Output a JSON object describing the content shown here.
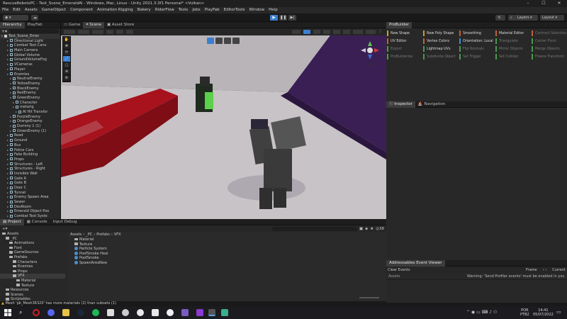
{
  "window": {
    "title": "RescueRobotsPC - Test_Scene_EmeraldAI - Windows, Mac, Linux - Unity 2021.3.3f1 Personal* <Vulkan>"
  },
  "menu": [
    "File",
    "Edit",
    "Assets",
    "GameObject",
    "Component",
    "Animation Rigging",
    "Bakery",
    "RiderFlow",
    "Tools",
    "Jobs",
    "PlayFab",
    "EditorTools",
    "Window",
    "Help"
  ],
  "toolbar": {
    "layers": "Layers",
    "layout": "Layout"
  },
  "hierarchy": {
    "tabs": [
      "Hierarchy",
      "PlayFab"
    ],
    "root": "Test_Scene_Emer",
    "items": [
      {
        "label": "Directional Light",
        "indent": 2
      },
      {
        "label": "Combat Text Canv",
        "indent": 2
      },
      {
        "label": "Main Camera",
        "indent": 2
      },
      {
        "label": "Global Volume",
        "indent": 2
      },
      {
        "label": "GroundVolumeFog",
        "indent": 2
      },
      {
        "label": "VCameras",
        "indent": 2
      },
      {
        "label": "Player",
        "indent": 2
      },
      {
        "label": "Enemies",
        "indent": 2
      },
      {
        "label": "NeutralEnemy",
        "indent": 3
      },
      {
        "label": "YellowEnemy",
        "indent": 3
      },
      {
        "label": "BlackEnemy",
        "indent": 3
      },
      {
        "label": "RedEnemy",
        "indent": 3
      },
      {
        "label": "GreenEnemy",
        "indent": 3
      },
      {
        "label": "Character",
        "indent": 4
      },
      {
        "label": "metarig",
        "indent": 4
      },
      {
        "label": "AI Hit Transfor",
        "indent": 5
      },
      {
        "label": "PurpleEnemy",
        "indent": 3
      },
      {
        "label": "OrangeEnemy",
        "indent": 3
      },
      {
        "label": "Dummy 1 (1)",
        "indent": 3
      },
      {
        "label": "GreenEnemy (1)",
        "indent": 3
      },
      {
        "label": "Road",
        "indent": 2
      },
      {
        "label": "Ground",
        "indent": 2
      },
      {
        "label": "Bus",
        "indent": 2
      },
      {
        "label": "Police Cars",
        "indent": 2
      },
      {
        "label": "Fake Building",
        "indent": 2
      },
      {
        "label": "Props",
        "indent": 2
      },
      {
        "label": "Structures - Left",
        "indent": 2
      },
      {
        "label": "Structures - Right",
        "indent": 2
      },
      {
        "label": "Invisible Wall",
        "indent": 2
      },
      {
        "label": "Gate A",
        "indent": 2
      },
      {
        "label": "Gate B",
        "indent": 2
      },
      {
        "label": "Door C",
        "indent": 2
      },
      {
        "label": "Tunnel",
        "indent": 2
      },
      {
        "label": "Enemy Spawn Area",
        "indent": 2
      },
      {
        "label": "Sewer",
        "indent": 2
      },
      {
        "label": "DevRoom",
        "indent": 2
      },
      {
        "label": "Emerald Object Poo",
        "indent": 2
      },
      {
        "label": "Combat Text Syste",
        "indent": 2
      }
    ]
  },
  "center": {
    "tabs": [
      "Game",
      "Scene",
      "Asset Store"
    ],
    "gizmo_label": "< Persp"
  },
  "probuilder": {
    "tab": "ProBuilder",
    "buttons": [
      {
        "label": "New Shape",
        "color": "#c9a227",
        "dim": false
      },
      {
        "label": "New Poly Shape",
        "color": "#c9a227",
        "dim": false
      },
      {
        "label": "Smoothing",
        "color": "#c0603a",
        "dim": false
      },
      {
        "label": "Material Editor",
        "color": "#c0603a",
        "dim": false
      },
      {
        "label": "Contract Selection",
        "color": "#c0603a",
        "dim": true
      },
      {
        "label": "UV Editor",
        "color": "#c0603a",
        "dim": false
      },
      {
        "label": "Vertex Colors",
        "color": "#c0603a",
        "dim": false
      },
      {
        "label": "Orientation: Local",
        "color": "#3a8fd0",
        "dim": false
      },
      {
        "label": "Triangulate",
        "color": "#4a9a4a",
        "dim": true
      },
      {
        "label": "Center Pivot",
        "color": "#4a9a4a",
        "dim": true
      },
      {
        "label": "Export",
        "color": "#4a9a4a",
        "dim": true
      },
      {
        "label": "Lightmap UVs",
        "color": "#4a9a4a",
        "dim": false
      },
      {
        "label": "Flip Normals",
        "color": "#4a9a4a",
        "dim": true
      },
      {
        "label": "Mirror Objects",
        "color": "#4a9a4a",
        "dim": true
      },
      {
        "label": "Merge Objects",
        "color": "#4a9a4a",
        "dim": true
      },
      {
        "label": "ProBuilderize",
        "color": "#4a9a4a",
        "dim": true
      },
      {
        "label": "Subdivide Object",
        "color": "#4a9a4a",
        "dim": true
      },
      {
        "label": "Set Trigger",
        "color": "#4a9a4a",
        "dim": true
      },
      {
        "label": "Set Collider",
        "color": "#4a9a4a",
        "dim": true
      },
      {
        "label": "Freeze Transform",
        "color": "#4a9a4a",
        "dim": true
      }
    ]
  },
  "inspector": {
    "tabs": [
      "Inspector",
      "Navigation"
    ]
  },
  "addressables": {
    "tab": "Addressables Event Viewer",
    "clear": "Clear Events",
    "frame": "Frame",
    "current": "Current",
    "assets": "Assets",
    "warning": "Warning: 'Send Profiler events' must be enabled in you"
  },
  "project": {
    "tabs": [
      "Project",
      "Console",
      "Input Debug"
    ],
    "count": "38",
    "breadcrumb": [
      "Assets",
      "_PC",
      "Prefabs",
      "VFX"
    ],
    "tree": [
      {
        "label": "Assets",
        "indent": 0
      },
      {
        "label": "_PC",
        "indent": 1
      },
      {
        "label": "Animations",
        "indent": 2
      },
      {
        "label": "Font",
        "indent": 2
      },
      {
        "label": "GameSources",
        "indent": 2
      },
      {
        "label": "Prefabs",
        "indent": 2
      },
      {
        "label": "Characters",
        "indent": 3
      },
      {
        "label": "Enemies",
        "indent": 3
      },
      {
        "label": "Props",
        "indent": 3
      },
      {
        "label": "VFX",
        "indent": 3
      },
      {
        "label": "Material",
        "indent": 4
      },
      {
        "label": "Texture",
        "indent": 4
      },
      {
        "label": "Resources",
        "indent": 1
      },
      {
        "label": "Scenes",
        "indent": 1
      },
      {
        "label": "Scriptables",
        "indent": 1
      }
    ],
    "assets": [
      {
        "label": "Material",
        "type": "folder"
      },
      {
        "label": "Texture",
        "type": "folder"
      },
      {
        "label": "Particle System",
        "type": "prefab"
      },
      {
        "label": "PoofSmoke Heal",
        "type": "prefab"
      },
      {
        "label": "PoofSmoke",
        "type": "prefab"
      },
      {
        "label": "SpawnAreaNew",
        "type": "prefab"
      }
    ]
  },
  "status": "Mesh 'pb_Mesh36320' has more materials (2) than subsets (1)",
  "taskbar": {
    "lang": "POR",
    "lang2": "PTB2",
    "time": "14:41",
    "date": "05/07/2022"
  }
}
